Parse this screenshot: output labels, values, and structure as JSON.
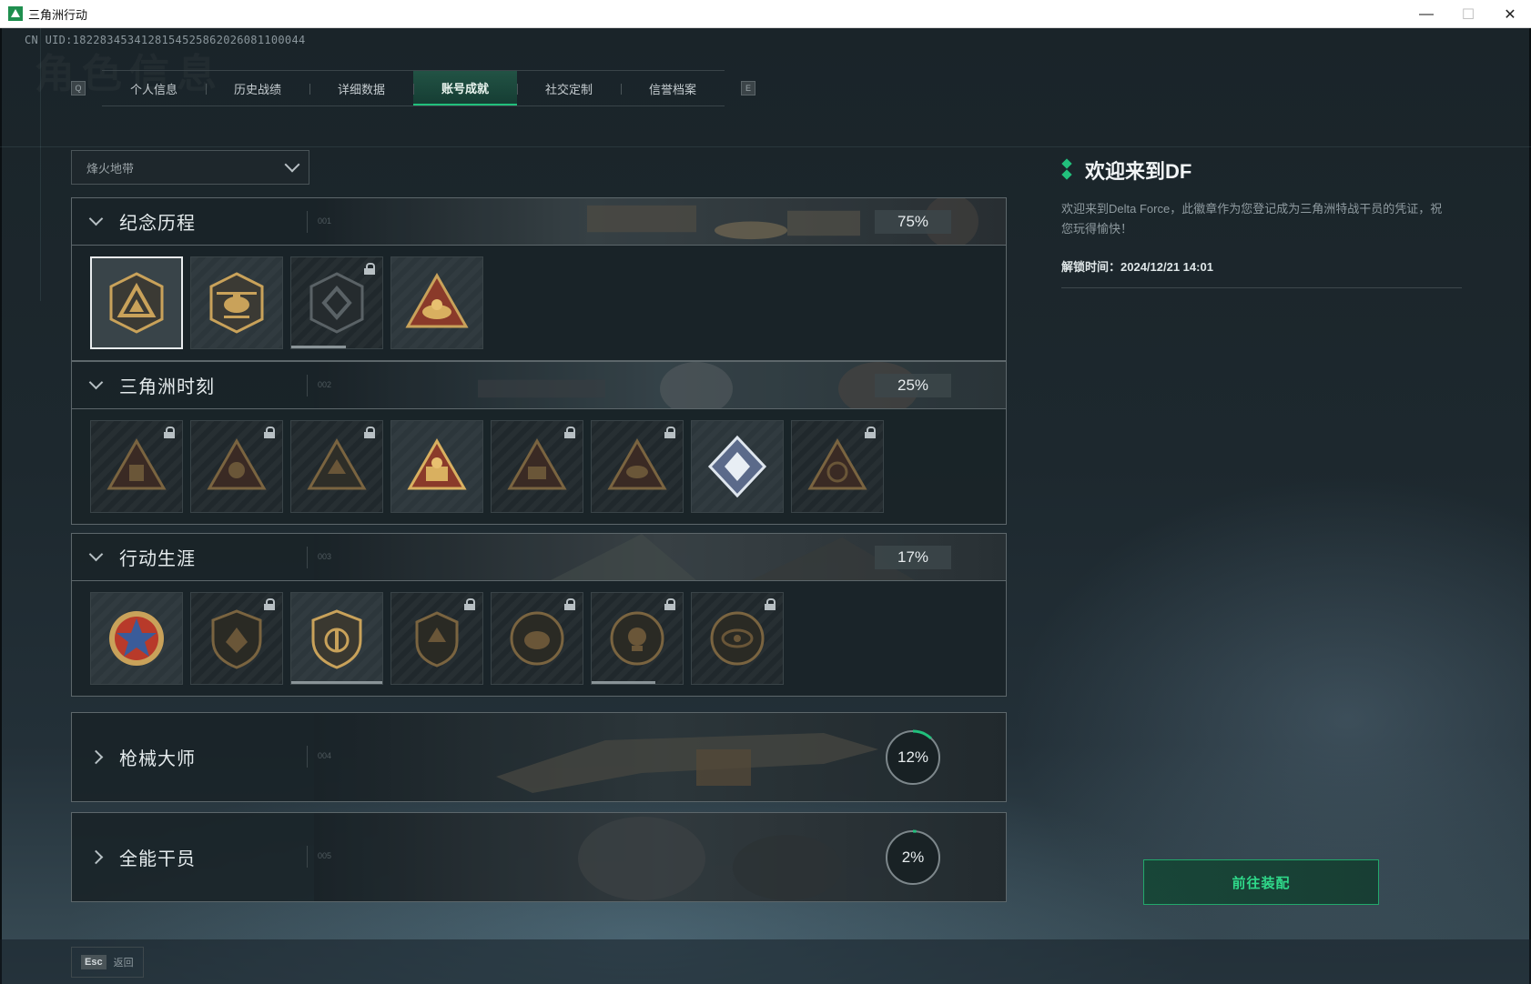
{
  "window": {
    "title": "三角洲行动",
    "minimize": "—",
    "maximize": "☐",
    "close": "✕"
  },
  "uid": "CN UID:1822834534128154525862026081100044",
  "bg_title": "角色信息",
  "tabs": {
    "q_key": "Q",
    "e_key": "E",
    "items": [
      {
        "label": "个人信息",
        "active": false
      },
      {
        "label": "历史战绩",
        "active": false
      },
      {
        "label": "详细数据",
        "active": false
      },
      {
        "label": "账号成就",
        "active": true
      },
      {
        "label": "社交定制",
        "active": false
      },
      {
        "label": "信誉档案",
        "active": false
      }
    ]
  },
  "dropdown": {
    "value": "烽火地带"
  },
  "categories": [
    {
      "title": "纪念历程",
      "num": "001",
      "percent": "75%",
      "expanded": true
    },
    {
      "title": "三角洲时刻",
      "num": "002",
      "percent": "25%",
      "expanded": true
    },
    {
      "title": "行动生涯",
      "num": "003",
      "percent": "17%",
      "expanded": true
    },
    {
      "title": "枪械大师",
      "num": "004",
      "percent": "12%",
      "progress": 0.12,
      "expanded": false
    },
    {
      "title": "全能干员",
      "num": "005",
      "percent": "2%",
      "progress": 0.02,
      "expanded": false
    }
  ],
  "info": {
    "title": "欢迎来到DF",
    "description": "欢迎来到Delta Force，此徽章作为您登记成为三角洲特战干员的凭证，祝您玩得愉快！",
    "unlock": "解锁时间：2024/12/21 14:01"
  },
  "equip_button": "前往装配",
  "back": {
    "key": "Esc",
    "label": "返回"
  },
  "colors": {
    "accent": "#21c07c",
    "gold": "#c9a25a",
    "panel": "#1a2328"
  }
}
